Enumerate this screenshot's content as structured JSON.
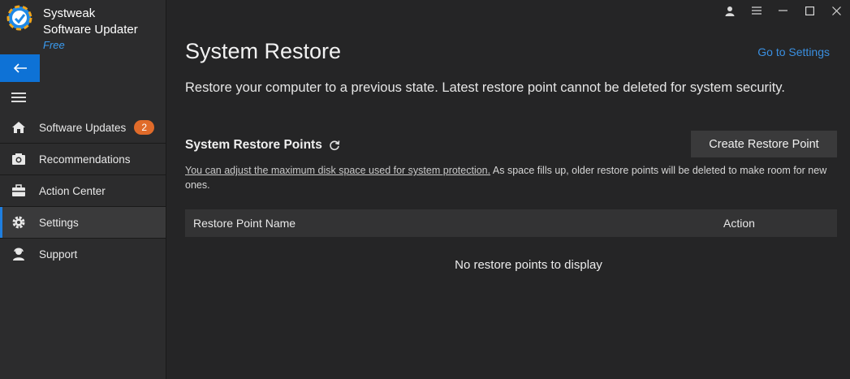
{
  "app": {
    "name_line1": "Systweak",
    "name_line2": "Software Updater",
    "edition": "Free"
  },
  "sidebar": {
    "items": [
      {
        "label": "Software Updates",
        "badge": "2"
      },
      {
        "label": "Recommendations"
      },
      {
        "label": "Action Center"
      },
      {
        "label": "Settings",
        "active": true
      },
      {
        "label": "Support"
      }
    ]
  },
  "main": {
    "title": "System Restore",
    "goto_settings": "Go to Settings",
    "description": "Restore your computer to a previous state. Latest restore point cannot be deleted for system security.",
    "section_title": "System Restore Points",
    "create_button": "Create Restore Point",
    "note_link": "You can adjust the maximum disk space used for system protection.",
    "note_text": " As space fills up, older restore points will be deleted to make room for new ones.",
    "table": {
      "columns": [
        "Restore Point Name",
        "Action"
      ],
      "empty_message": "No restore points to display"
    }
  },
  "colors": {
    "accent": "#0e72d6",
    "badge": "#e06b2a",
    "link": "#3a8fe0",
    "background": "#252526",
    "sidebar": "#2c2c2d"
  }
}
